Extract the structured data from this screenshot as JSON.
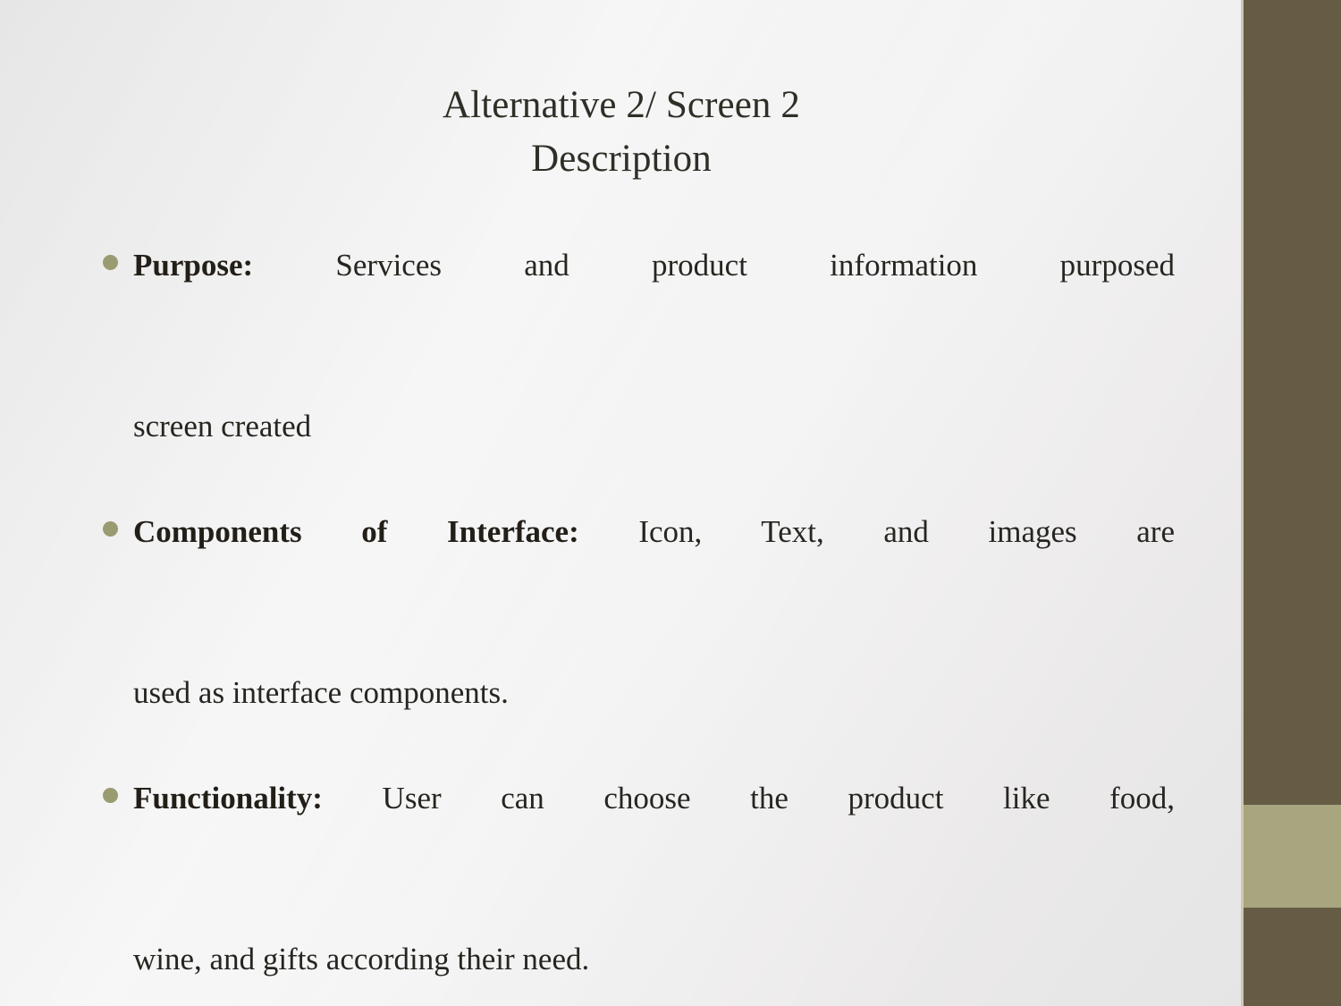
{
  "slide": {
    "title": {
      "line1": "Alternative 2/ Screen 2",
      "line2": "Description"
    },
    "bullets": [
      {
        "lead": "Purpose:",
        "body": " Services and product information purposed",
        "tail": "screen created"
      },
      {
        "lead": "Components of Interface:",
        "body": " Icon, Text, and images are",
        "tail": "used as interface components."
      },
      {
        "lead": "Functionality:",
        "body": " User can choose the product like food,",
        "tail": "wine, and  gifts  according their need."
      }
    ],
    "bullet_glyph": "•"
  },
  "theme": {
    "background_light": "#ececec",
    "rail_dark": "#665c44",
    "rail_khaki": "#a9a67f",
    "rail_hairline": "#cfc8b6",
    "bullet_dot_color": "#9b9b72",
    "title_color": "#2f2f27",
    "body_color": "#262621",
    "lead_color": "#231f18"
  }
}
